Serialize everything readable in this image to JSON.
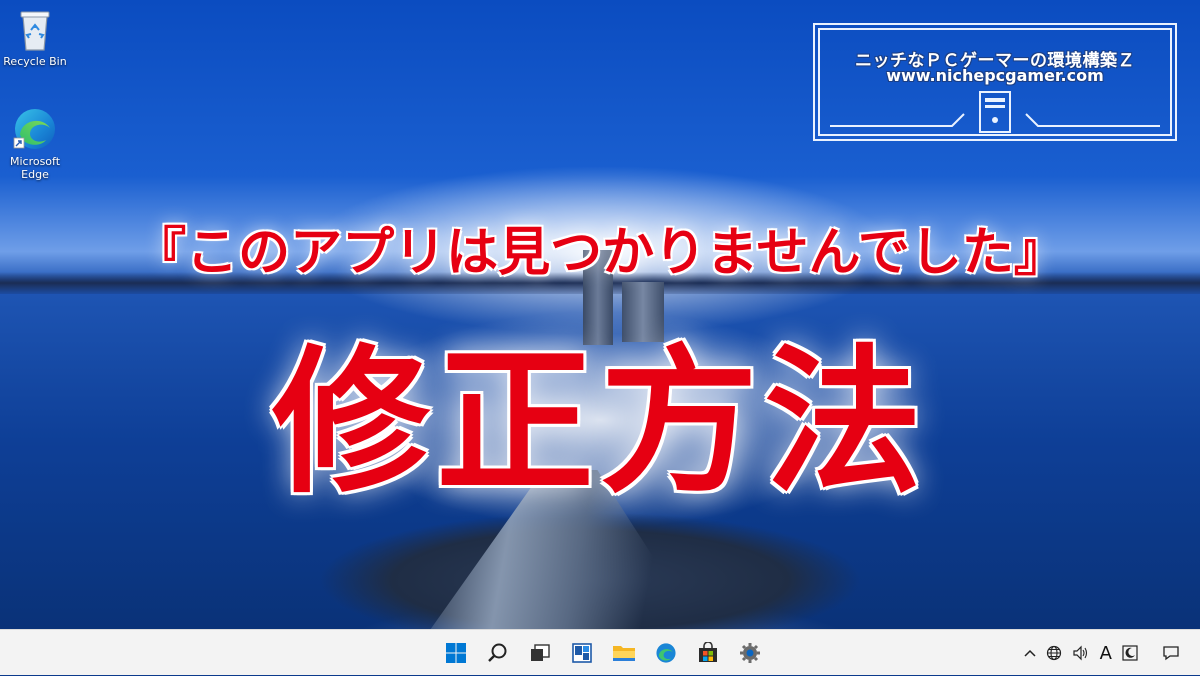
{
  "desktop": {
    "icons": [
      {
        "label": "Recycle Bin"
      },
      {
        "label": "Microsoft Edge"
      }
    ]
  },
  "logo": {
    "title": "ニッチなＰＣゲーマーの環境構築Ｚ",
    "url": "www.nichepcgamer.com"
  },
  "headline": {
    "line1": "『このアプリは見つかりませんでした』",
    "line2": "修正方法"
  },
  "taskbar": {
    "apps": [
      {
        "icon": "windows-start-icon"
      },
      {
        "icon": "search-icon"
      },
      {
        "icon": "task-view-icon"
      },
      {
        "icon": "widgets-icon"
      },
      {
        "icon": "file-explorer-icon"
      },
      {
        "icon": "edge-icon"
      },
      {
        "icon": "store-icon"
      },
      {
        "icon": "settings-icon"
      }
    ],
    "tray": {
      "ime": "A"
    }
  },
  "colors": {
    "headline": "#e60012",
    "taskbar": "#f3f3f3",
    "windows_blue": "#0078d4"
  }
}
